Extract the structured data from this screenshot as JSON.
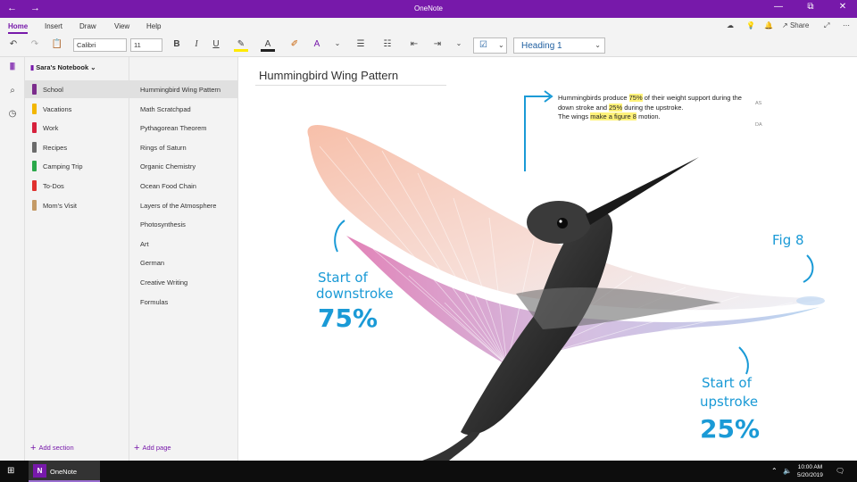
{
  "window": {
    "title": "OneNote",
    "back_icon": "←",
    "forward_icon": "→",
    "minimize": "—",
    "maximize": "⧉",
    "close": "✕"
  },
  "menu": {
    "tabs": [
      "Home",
      "Insert",
      "Draw",
      "View",
      "Help"
    ],
    "share_label": "Share"
  },
  "toolbar": {
    "font_name": "Calibri",
    "font_size": "11",
    "style": "Heading 1"
  },
  "notebook": {
    "name": "Sara's Notebook",
    "sections": [
      {
        "label": "School",
        "color": "#7b2c8c"
      },
      {
        "label": "Vacations",
        "color": "#f2b600"
      },
      {
        "label": "Work",
        "color": "#d6213c"
      },
      {
        "label": "Recipes",
        "color": "#6b6b6b"
      },
      {
        "label": "Camping Trip",
        "color": "#2aa84a"
      },
      {
        "label": "To-Dos",
        "color": "#e0312f"
      },
      {
        "label": "Mom's Visit",
        "color": "#c49a66"
      }
    ],
    "add_section_label": "Add section"
  },
  "pages": {
    "items": [
      "Hummingbird Wing Pattern",
      "Math Scratchpad",
      "Pythagorean Theorem",
      "Rings of Saturn",
      "Organic Chemistry",
      "Ocean Food Chain",
      "Layers of the Atmosphere",
      "Photosynthesis",
      "Art",
      "German",
      "Creative Writing",
      "Formulas"
    ],
    "add_page_label": "Add page"
  },
  "canvas": {
    "page_title": "Hummingbird Wing Pattern",
    "note_parts": [
      {
        "text": "Hummingbirds produce ",
        "hl": false
      },
      {
        "text": "75%",
        "hl": true
      },
      {
        "text": " of their weight support during the down stroke and ",
        "hl": false
      },
      {
        "text": "25%",
        "hl": true
      },
      {
        "text": " during the upstroke.",
        "hl": false
      }
    ],
    "note_line2_parts": [
      {
        "text": "The wings ",
        "hl": false
      },
      {
        "text": "make a figure 8",
        "hl": true
      },
      {
        "text": " motion.",
        "hl": false
      }
    ],
    "tags": [
      "AS",
      "DA"
    ],
    "ink_downstroke_1": "Start of",
    "ink_downstroke_2": "downstroke",
    "ink_downstroke_pct": "75%",
    "ink_upstroke_1": "Start of",
    "ink_upstroke_2": "upstroke",
    "ink_upstroke_pct": "25%",
    "ink_fig8": "Fig 8"
  },
  "taskbar": {
    "app_label": "OneNote",
    "time": "10:00 AM",
    "date": "5/20/2019"
  }
}
